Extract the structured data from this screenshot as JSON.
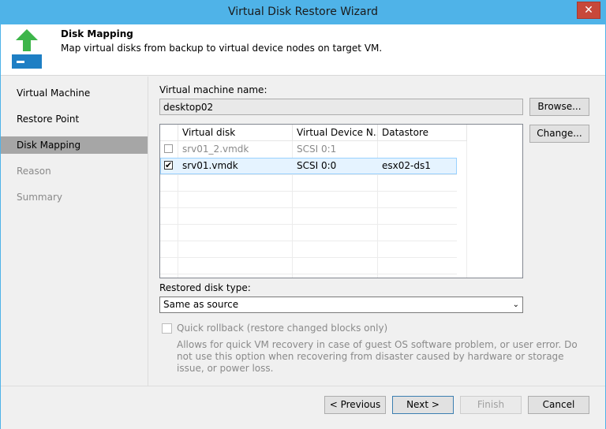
{
  "window": {
    "title": "Virtual Disk Restore Wizard",
    "close_glyph": "✕"
  },
  "header": {
    "title": "Disk Mapping",
    "description": "Map virtual disks from backup to virtual device nodes on target VM.",
    "icon": "restore-arrow-icon"
  },
  "nav": {
    "items": [
      {
        "label": "Virtual Machine",
        "state": "done"
      },
      {
        "label": "Restore Point",
        "state": "done"
      },
      {
        "label": "Disk Mapping",
        "state": "active"
      },
      {
        "label": "Reason",
        "state": "pending"
      },
      {
        "label": "Summary",
        "state": "pending"
      }
    ]
  },
  "vm": {
    "label": "Virtual machine name:",
    "value": "desktop02",
    "browse_label": "Browse..."
  },
  "disks": {
    "change_label": "Change...",
    "columns": [
      "Virtual disk",
      "Virtual Device N...",
      "Datastore"
    ],
    "rows": [
      {
        "checked": false,
        "disk": "srv01_2.vmdk",
        "node": "SCSI 0:1",
        "datastore": ""
      },
      {
        "checked": true,
        "disk": "srv01.vmdk",
        "node": "SCSI 0:0",
        "datastore": "esx02-ds1"
      }
    ],
    "check_glyph": "✔"
  },
  "disk_type": {
    "label": "Restored disk type:",
    "selected": "Same as source",
    "arrow": "⌄"
  },
  "rollback": {
    "label": "Quick rollback (restore changed blocks only)",
    "description": "Allows for quick VM recovery in case of guest OS software problem, or user error. Do not use this option when recovering from disaster caused by hardware or storage issue, or power loss."
  },
  "footer": {
    "previous": "< Previous",
    "next": "Next >",
    "finish": "Finish",
    "cancel": "Cancel"
  },
  "colors": {
    "titlebar": "#4fb3e8",
    "accent_green": "#3db54a",
    "accent_blue": "#1e7fc4"
  }
}
